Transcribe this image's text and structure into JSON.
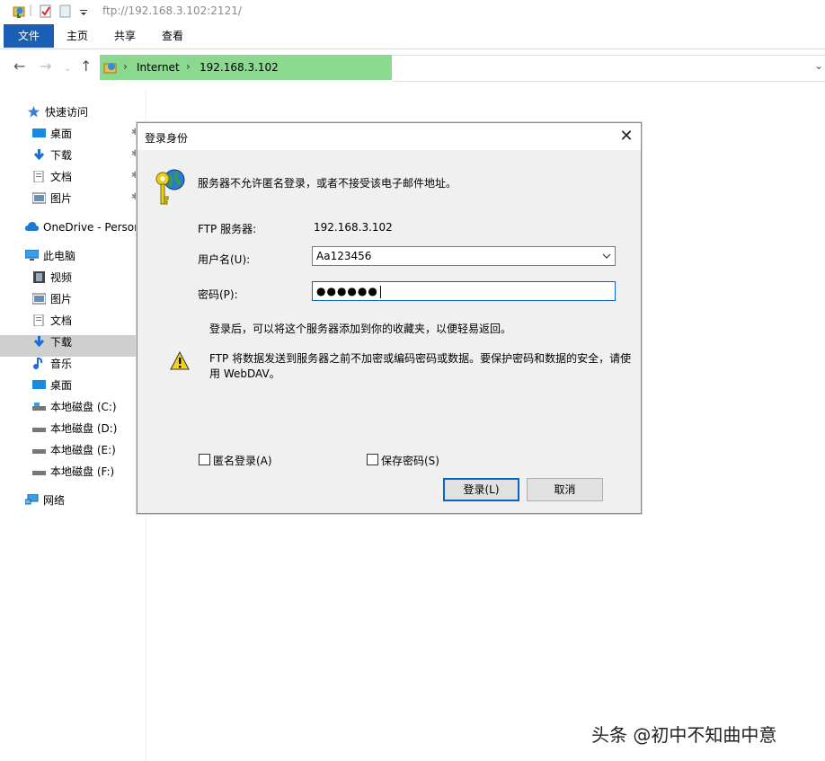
{
  "window": {
    "title": "ftp://192.168.3.102:2121/"
  },
  "ribbon": {
    "tabs": [
      {
        "label": "文件"
      },
      {
        "label": "主页"
      },
      {
        "label": "共享"
      },
      {
        "label": "查看"
      }
    ]
  },
  "address": {
    "crumbs": [
      "Internet",
      "192.168.3.102"
    ]
  },
  "sidebar": {
    "quick_access": "快速访问",
    "quick_items": [
      "桌面",
      "下载",
      "文档",
      "图片"
    ],
    "onedrive": "OneDrive - Persor",
    "this_pc": "此电脑",
    "pc_items": [
      "视频",
      "图片",
      "文档",
      "下载",
      "音乐",
      "桌面",
      "本地磁盘 (C:)",
      "本地磁盘 (D:)",
      "本地磁盘 (E:)",
      "本地磁盘 (F:)"
    ],
    "network": "网络"
  },
  "dialog": {
    "title": "登录身份",
    "message": "服务器不允许匿名登录，或者不接受该电子邮件地址。",
    "server_label": "FTP 服务器:",
    "server_value": "192.168.3.102",
    "username_label": "用户名(U):",
    "username_value": "Aa123456",
    "password_label": "密码(P):",
    "password_mask": "●●●●●●",
    "hint": "登录后，可以将这个服务器添加到你的收藏夹，以便轻易返回。",
    "warning_line1": "FTP 将数据发送到服务器之前不加密或编码密码或数据。要保护密码和数据的安全，请使",
    "warning_line2": "用 WebDAV。",
    "anonymous_label": "匿名登录(A)",
    "save_password_label": "保存密码(S)",
    "login_button": "登录(L)",
    "cancel_button": "取消"
  },
  "watermark": "头条 @初中不知曲中意",
  "colors": {
    "address_highlight": "#8bd88f",
    "file_tab": "#1a5fb4",
    "focus_border": "#0a64c8"
  }
}
